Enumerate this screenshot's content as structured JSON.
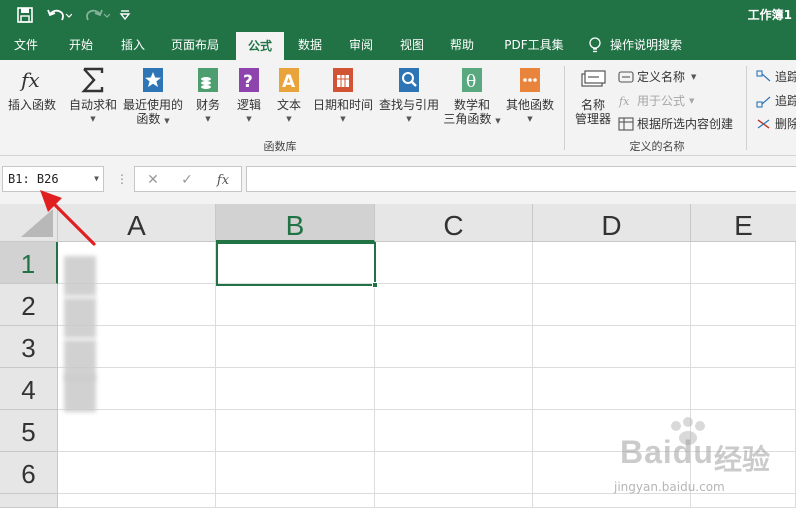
{
  "window": {
    "title": "工作簿1"
  },
  "menu_tabs": [
    "文件",
    "开始",
    "插入",
    "页面布局",
    "公式",
    "数据",
    "审阅",
    "视图",
    "帮助",
    "PDF工具集"
  ],
  "active_tab": "公式",
  "tell_me": "操作说明搜索",
  "ribbon": {
    "insert_function": "插入函数",
    "autosum": "自动求和",
    "recent_line1": "最近使用的",
    "recent_line2": "函数",
    "financial": "财务",
    "logical": "逻辑",
    "text": "文本",
    "datetime": "日期和时间",
    "lookup": "查找与引用",
    "math_line1": "数学和",
    "math_line2": "三角函数",
    "more": "其他函数",
    "function_library_label": "函数库",
    "name_manager_line1": "名称",
    "name_manager_line2": "管理器",
    "define_name": "定义名称",
    "use_in_formula": "用于公式",
    "create_from_selection": "根据所选内容创建",
    "defined_names_label": "定义的名称",
    "trace_precedents": "追踪",
    "trace_dependents": "追踪",
    "remove_arrows": "删除"
  },
  "formula_bar": {
    "name_box": "B1: B26",
    "fx": "fx",
    "formula": ""
  },
  "grid": {
    "columns": [
      "A",
      "B",
      "C",
      "D",
      "E"
    ],
    "rows": [
      "1",
      "2",
      "3",
      "4",
      "5",
      "6"
    ],
    "selected_column": "B",
    "selected_row": "1"
  },
  "watermark": {
    "brand": "Baidu",
    "brand_cn": "经验",
    "url": "jingyan.baidu.com"
  },
  "colors": {
    "excel_green": "#217346",
    "annotation_red": "#e02020"
  }
}
